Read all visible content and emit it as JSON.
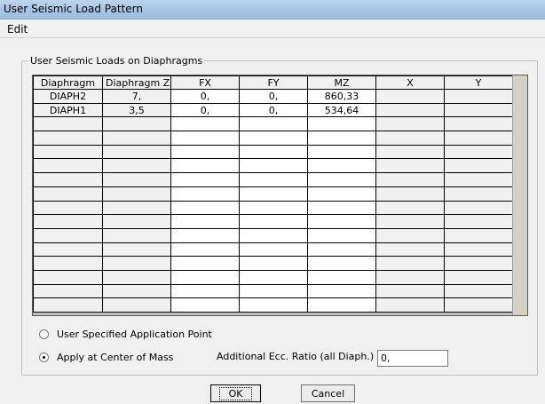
{
  "window": {
    "title": "User Seismic Load Pattern"
  },
  "menu": {
    "edit": "Edit"
  },
  "group": {
    "label": "User Seismic Loads on Diaphragms"
  },
  "table": {
    "columns": [
      "Diaphragm",
      "Diaphragm Z",
      "FX",
      "FY",
      "MZ",
      "X",
      "Y"
    ],
    "rows": [
      [
        "DIAPH2",
        "7,",
        "0,",
        "0,",
        "860,33",
        "",
        ""
      ],
      [
        "DIAPH1",
        "3,5",
        "0,",
        "0,",
        "534,64",
        "",
        ""
      ]
    ],
    "empty_row_count": 14
  },
  "options": {
    "user_point": "User Specified Application Point",
    "center_mass": "Apply at Center of Mass",
    "selected": "center_mass"
  },
  "ecc": {
    "label": "Additional Ecc. Ratio (all Diaph.)",
    "value": "0,"
  },
  "buttons": {
    "ok": "OK",
    "cancel": "Cancel"
  }
}
